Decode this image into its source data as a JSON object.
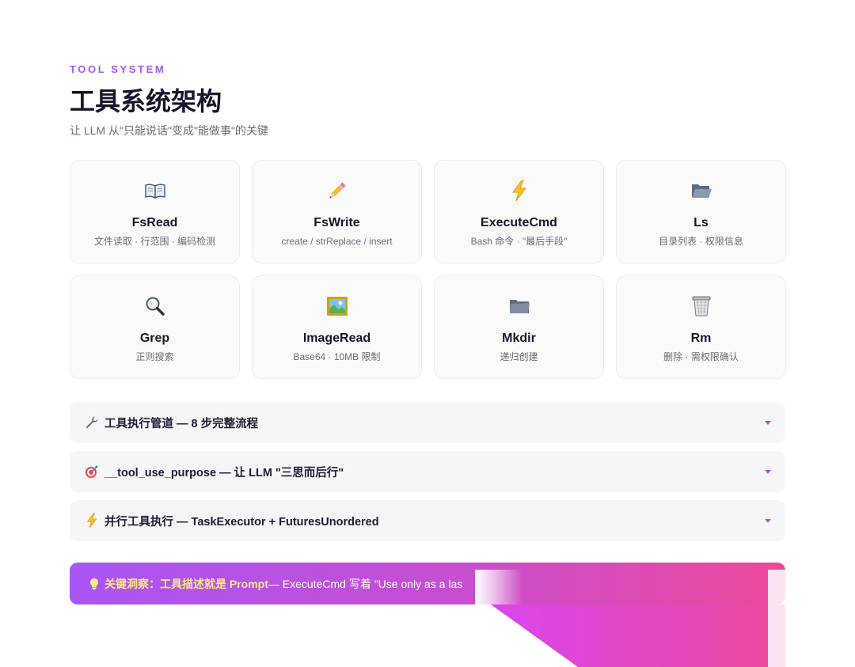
{
  "header": {
    "eyebrow": "TOOL SYSTEM",
    "title": "工具系统架构",
    "subtitle": "让 LLM 从\"只能说话\"变成\"能做事\"的关键"
  },
  "tools": [
    {
      "icon": "book-icon",
      "name": "FsRead",
      "desc": "文件读取 · 行范围 · 编码检测"
    },
    {
      "icon": "pencil-icon",
      "name": "FsWrite",
      "desc": "create / strReplace / insert"
    },
    {
      "icon": "lightning-icon",
      "name": "ExecuteCmd",
      "desc": "Bash 命令 · \"最后手段\""
    },
    {
      "icon": "open-folder-icon",
      "name": "Ls",
      "desc": "目录列表 · 权限信息"
    },
    {
      "icon": "magnifier-icon",
      "name": "Grep",
      "desc": "正则搜索"
    },
    {
      "icon": "framed-picture-icon",
      "name": "ImageRead",
      "desc": "Base64 · 10MB 限制"
    },
    {
      "icon": "folder-icon",
      "name": "Mkdir",
      "desc": "递归创建"
    },
    {
      "icon": "wastebasket-icon",
      "name": "Rm",
      "desc": "删除 · 需权限确认"
    }
  ],
  "accordions": [
    {
      "icon": "wrench-icon",
      "label": "工具执行管道 — 8 步完整流程"
    },
    {
      "icon": "target-icon",
      "label": "__tool_use_purpose — 让 LLM \"三思而后行\""
    },
    {
      "icon": "lightning-icon",
      "label": "并行工具执行 — TaskExecutor + FuturesUnordered"
    }
  ],
  "insight": {
    "icon": "lightbulb-icon",
    "highlight": "关键洞察：工具描述就是 Prompt",
    "text": " — ExecuteCmd 写着 \"Use only as a las"
  },
  "colors": {
    "accent": "#a855f7",
    "pink": "#ec4899",
    "highlight": "#fde68a"
  }
}
